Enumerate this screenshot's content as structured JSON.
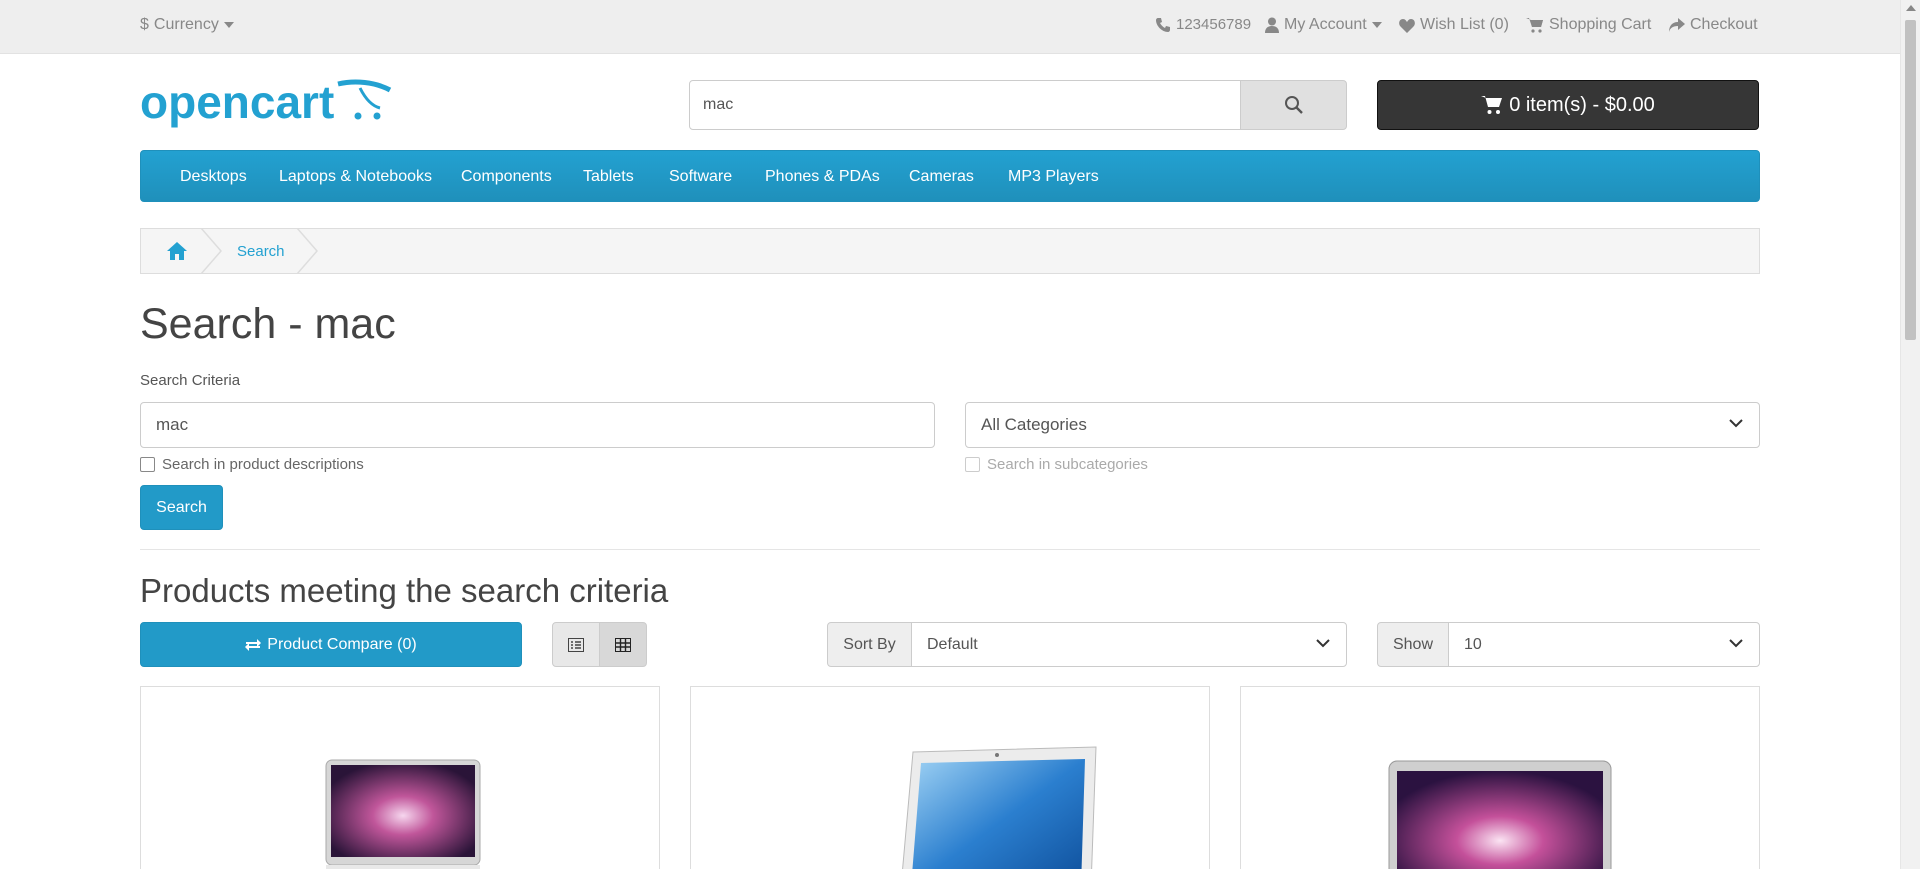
{
  "topbar": {
    "currency": "Currency",
    "currency_symbol": "$",
    "phone": "123456789",
    "my_account": "My Account",
    "wish_list": "Wish List (0)",
    "shopping_cart": "Shopping Cart",
    "checkout": "Checkout"
  },
  "header": {
    "logo_text": "opencart",
    "search_value": "mac",
    "cart_label": "0 item(s) - $0.00"
  },
  "menu": [
    "Desktops",
    "Laptops & Notebooks",
    "Components",
    "Tablets",
    "Software",
    "Phones & PDAs",
    "Cameras",
    "MP3 Players"
  ],
  "breadcrumb": {
    "current": "Search"
  },
  "page": {
    "title": "Search - mac",
    "criteria_label": "Search Criteria",
    "keyword_value": "mac",
    "category_value": "All Categories",
    "desc_check": "Search in product descriptions",
    "subcat_check": "Search in subcategories",
    "search_button": "Search",
    "results_title": "Products meeting the search criteria",
    "compare_button": "Product Compare (0)",
    "sort_label": "Sort By",
    "sort_value": "Default",
    "show_label": "Show",
    "show_value": "10"
  },
  "colors": {
    "brand": "#229ac8",
    "cart_bg": "#363636",
    "topbar_bg": "#eeeeee"
  }
}
